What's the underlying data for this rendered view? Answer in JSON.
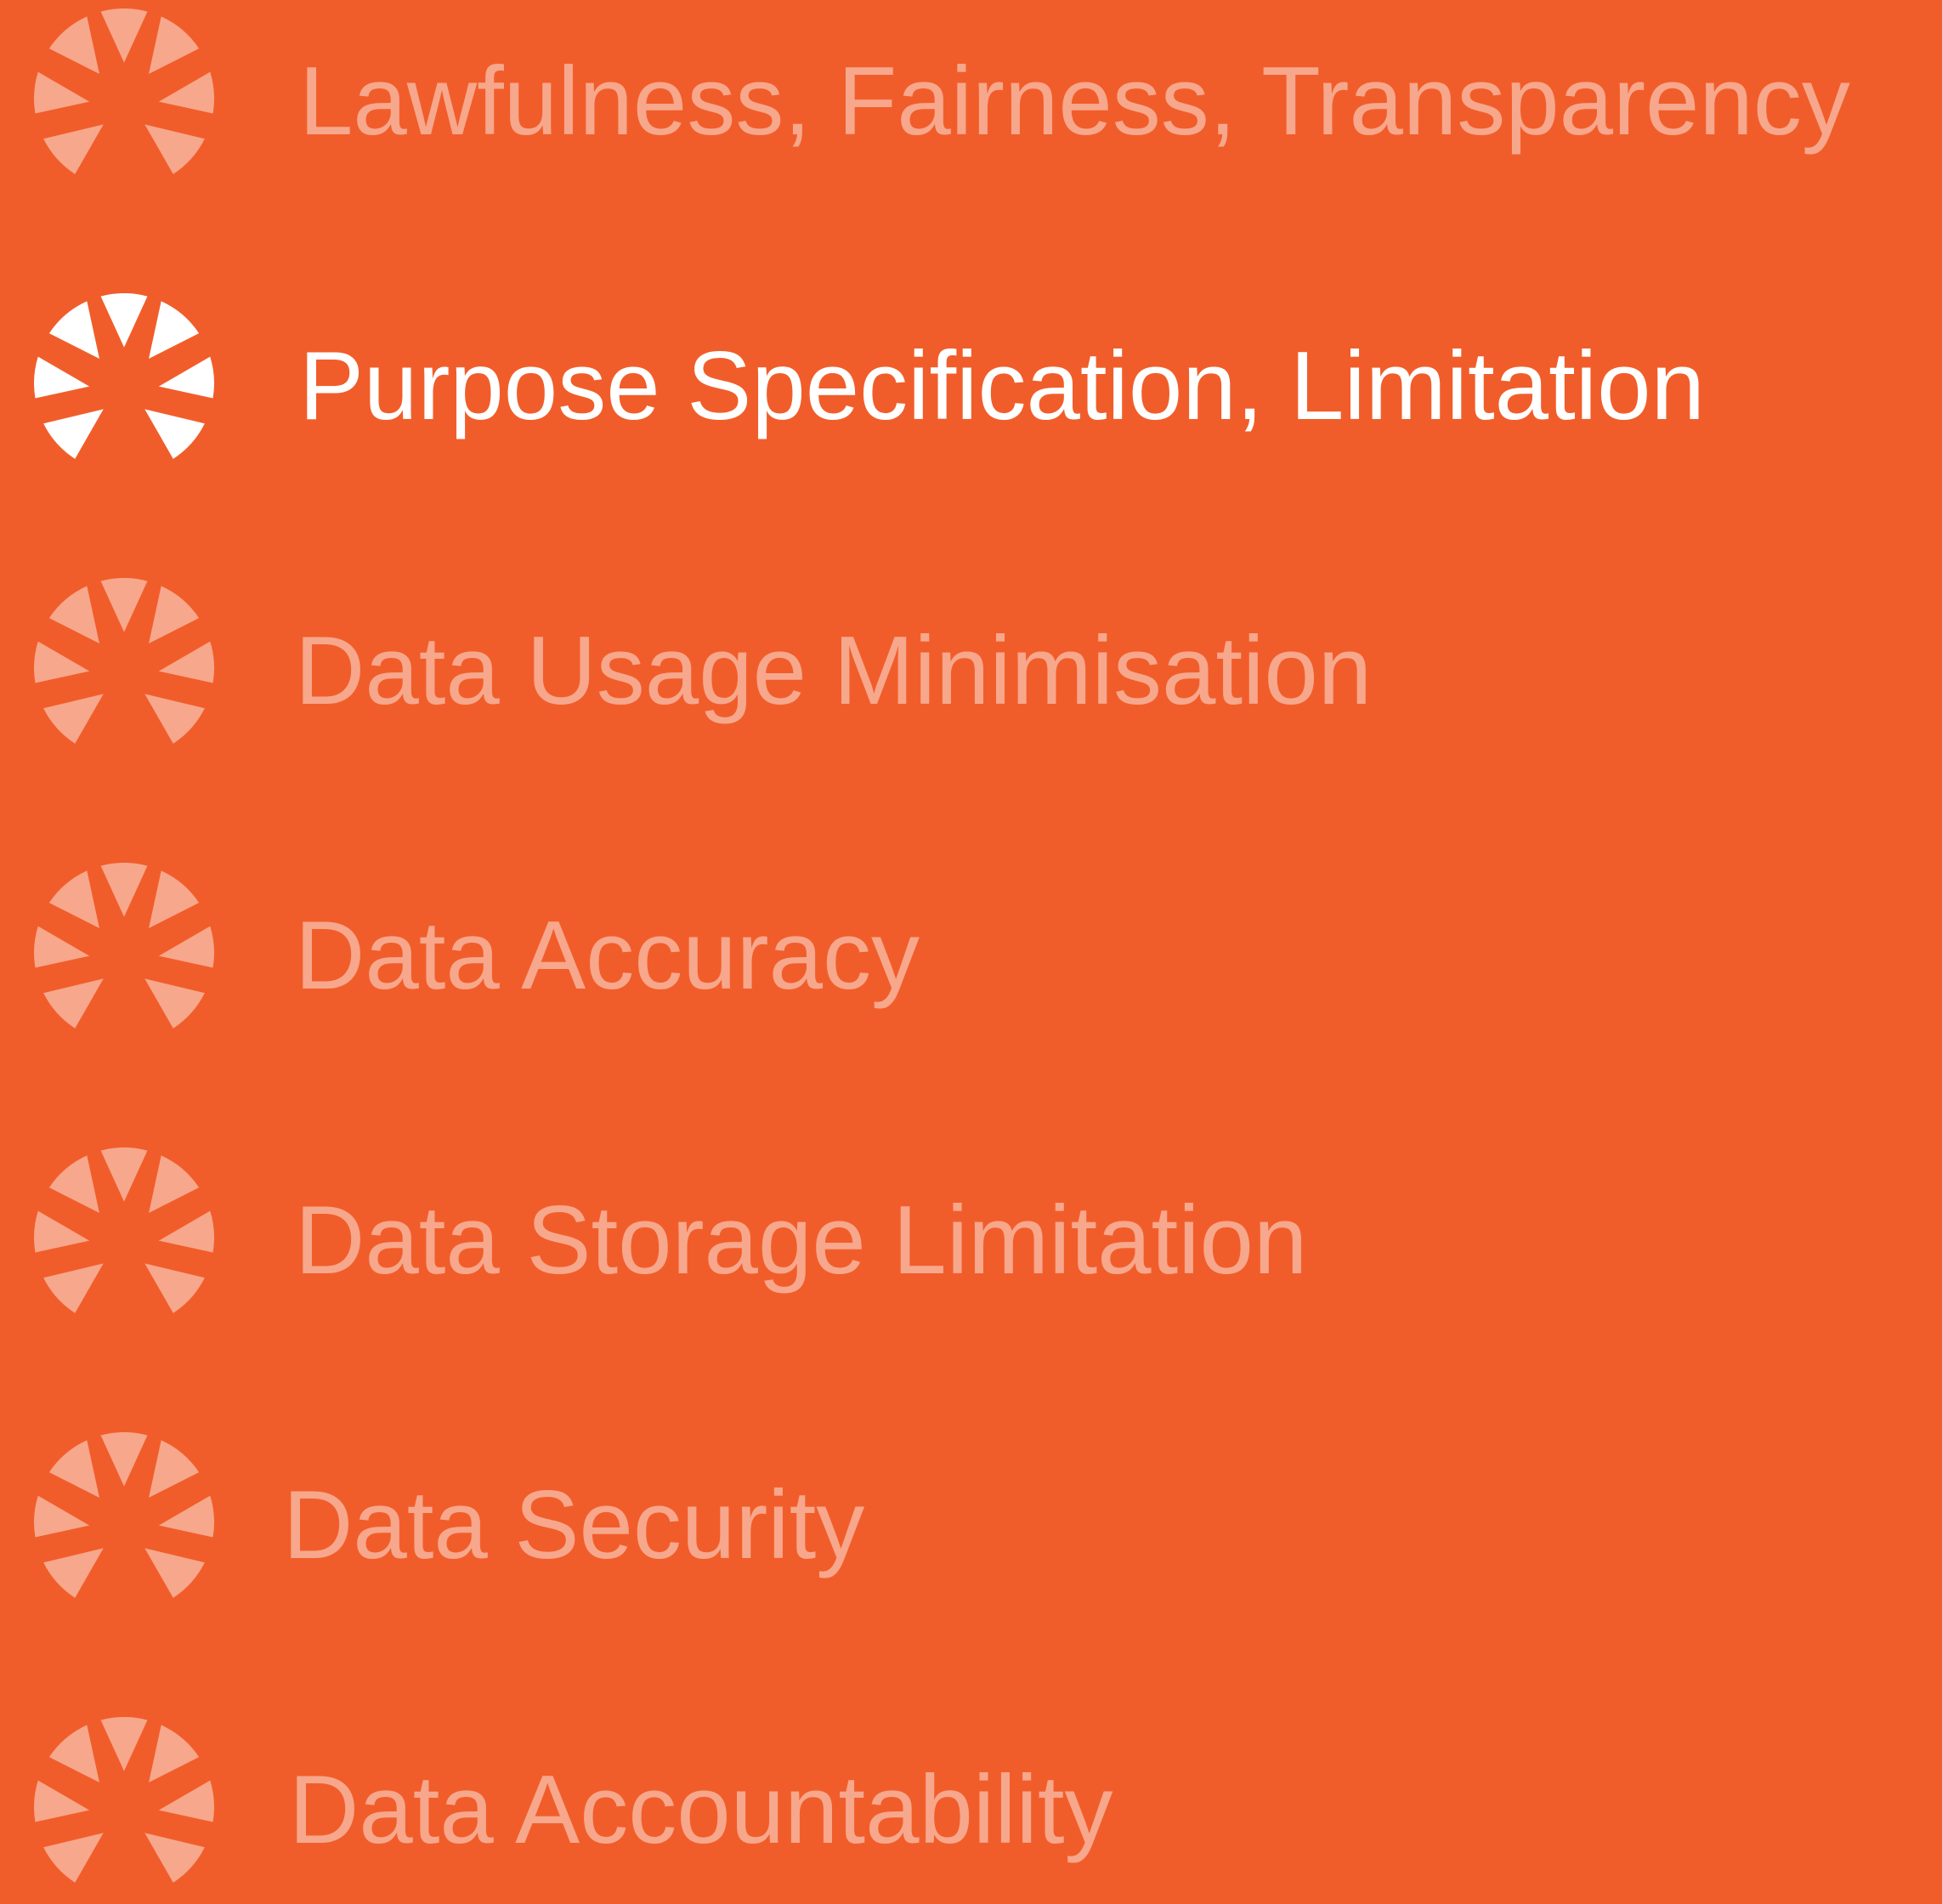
{
  "principles": [
    {
      "label": "Lawfulness, Fairness, Transparency",
      "icon": "sunburst-icon",
      "state": "muted"
    },
    {
      "label": "Purpose Specification, Limitation",
      "icon": "sunburst-icon",
      "state": "active"
    },
    {
      "label": "Data Usage Minimisation",
      "icon": "sunburst-icon",
      "state": "muted"
    },
    {
      "label": "Data Accuracy",
      "icon": "sunburst-icon",
      "state": "muted"
    },
    {
      "label": "Data Storage Limitation",
      "icon": "sunburst-icon",
      "state": "muted"
    },
    {
      "label": "Data Security",
      "icon": "sunburst-icon",
      "state": "muted"
    },
    {
      "label": "Data Accountability",
      "icon": "sunburst-icon",
      "state": "muted"
    }
  ],
  "colors": {
    "background": "#F15D2A",
    "muted": "#F7A78C",
    "active": "#FFFFFF"
  }
}
